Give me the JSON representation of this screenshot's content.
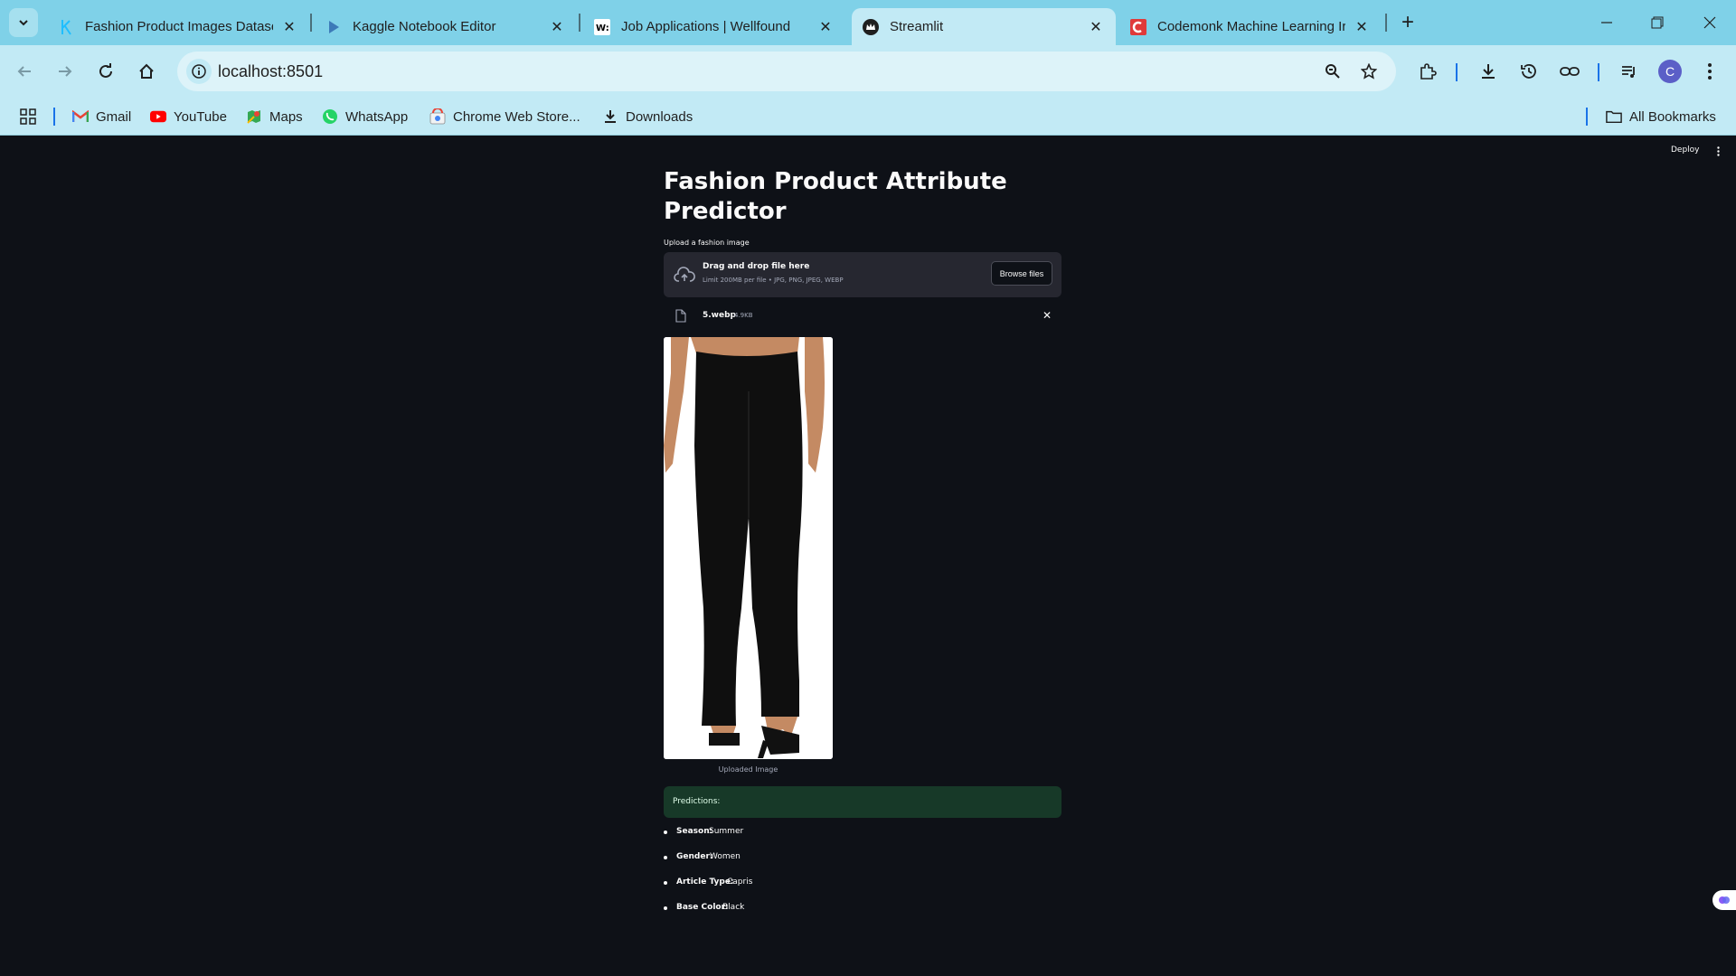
{
  "browser": {
    "tabs": [
      {
        "title": "Fashion Product Images Datase",
        "favicon": "kaggle-k-icon",
        "active": false
      },
      {
        "title": "Kaggle Notebook Editor",
        "favicon": "kaggle-play-icon",
        "active": false
      },
      {
        "title": "Job Applications | Wellfound",
        "favicon": "wellfound-icon",
        "active": false
      },
      {
        "title": "Streamlit",
        "favicon": "streamlit-crown-icon",
        "active": true
      },
      {
        "title": "Codemonk Machine Learning Ir",
        "favicon": "codemonk-icon",
        "active": false
      }
    ],
    "url": "localhost:8501",
    "profile_initial": "C",
    "bookmarks": [
      {
        "label": "Gmail",
        "icon": "gmail-icon"
      },
      {
        "label": "YouTube",
        "icon": "youtube-icon"
      },
      {
        "label": "Maps",
        "icon": "maps-icon"
      },
      {
        "label": "WhatsApp",
        "icon": "whatsapp-icon"
      },
      {
        "label": "Chrome Web Store...",
        "icon": "chrome-web-store-icon"
      },
      {
        "label": "Downloads",
        "icon": "download-icon"
      }
    ],
    "all_bookmarks_label": "All Bookmarks"
  },
  "app": {
    "deploy_label": "Deploy",
    "title": "Fashion Product Attribute Predictor",
    "uploader": {
      "label": "Upload a fashion image",
      "drop_text": "Drag and drop file here",
      "limit_text": "Limit 200MB per file • JPG, PNG, JPEG, WEBP",
      "browse_label": "Browse files"
    },
    "uploaded_file": {
      "name": "5.webp",
      "size": "4.9KB"
    },
    "image_caption": "Uploaded Image",
    "predictions_header": "Predictions:",
    "predictions": [
      {
        "key": "Season:",
        "value": "Summer"
      },
      {
        "key": "Gender:",
        "value": "Women"
      },
      {
        "key": "Article Type:",
        "value": "Capris"
      },
      {
        "key": "Base Color:",
        "value": "Black"
      }
    ],
    "colors": {
      "background": "#0e1117",
      "success_bg": "#173928",
      "dropzone_bg": "#262730"
    }
  }
}
